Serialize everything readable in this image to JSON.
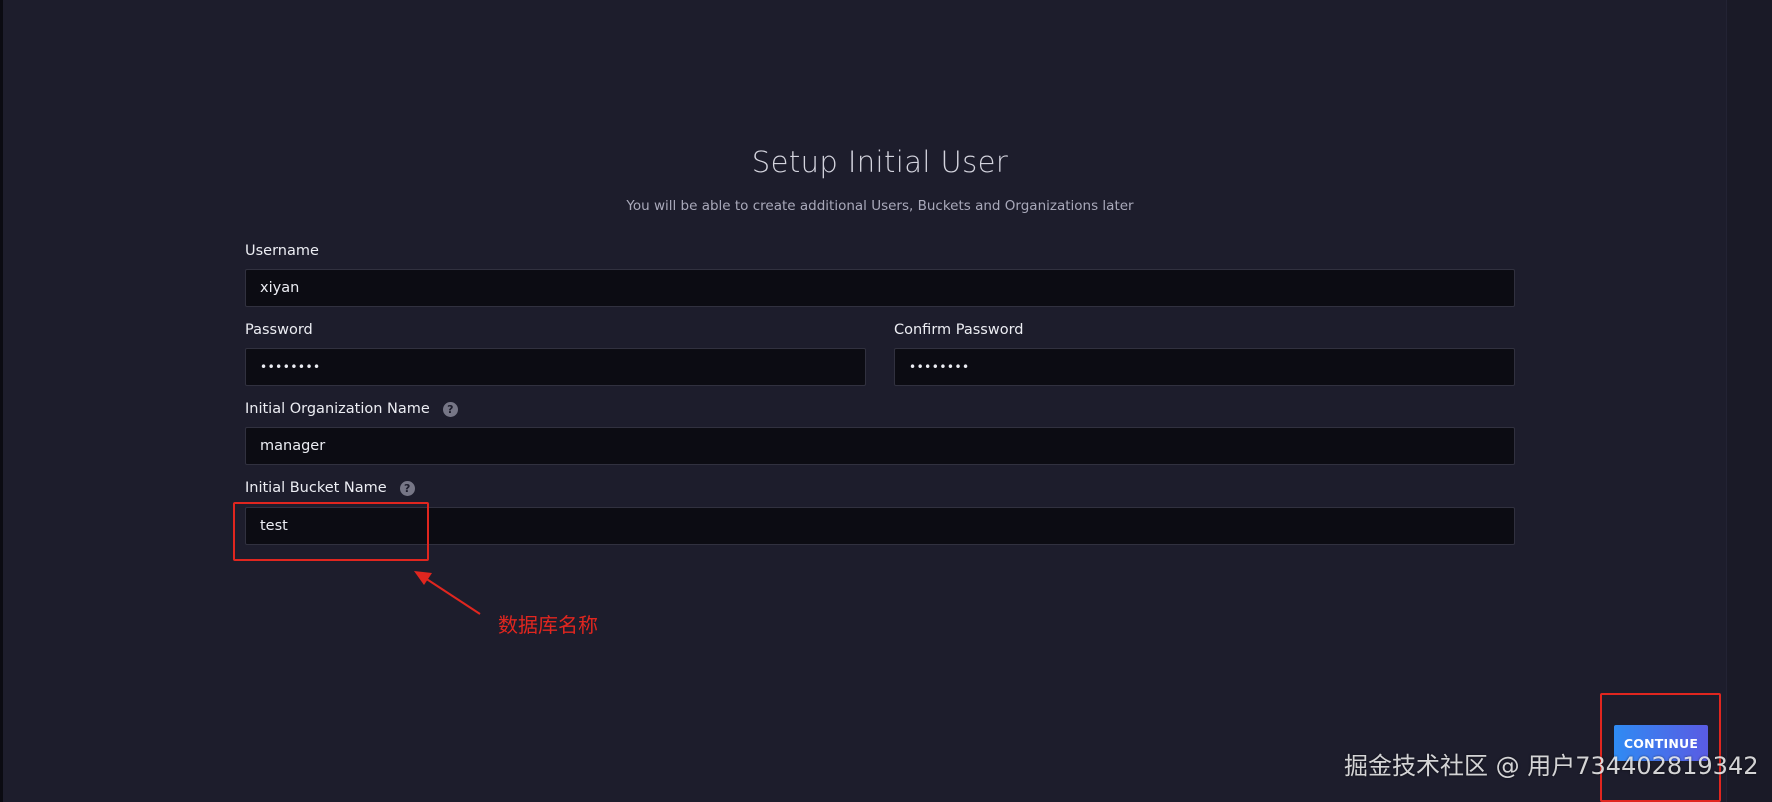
{
  "header": {
    "title": "Setup Initial User",
    "subtitle": "You will be able to create additional Users, Buckets and Organizations later"
  },
  "form": {
    "username": {
      "label": "Username",
      "value": "xiyan"
    },
    "password": {
      "label": "Password",
      "value": "••••••••"
    },
    "confirm_password": {
      "label": "Confirm Password",
      "value": "••••••••"
    },
    "organization": {
      "label": "Initial Organization Name",
      "value": "manager",
      "help_icon": "question-circle-icon"
    },
    "bucket": {
      "label": "Initial Bucket Name",
      "value": "test",
      "help_icon": "question-circle-icon"
    },
    "help_glyph": "?"
  },
  "annotation": {
    "text": "数据库名称",
    "color": "#e0261f"
  },
  "actions": {
    "continue_label": "CONTINUE"
  },
  "watermark": {
    "text": "掘金技术社区 @ 用户734402819342"
  }
}
